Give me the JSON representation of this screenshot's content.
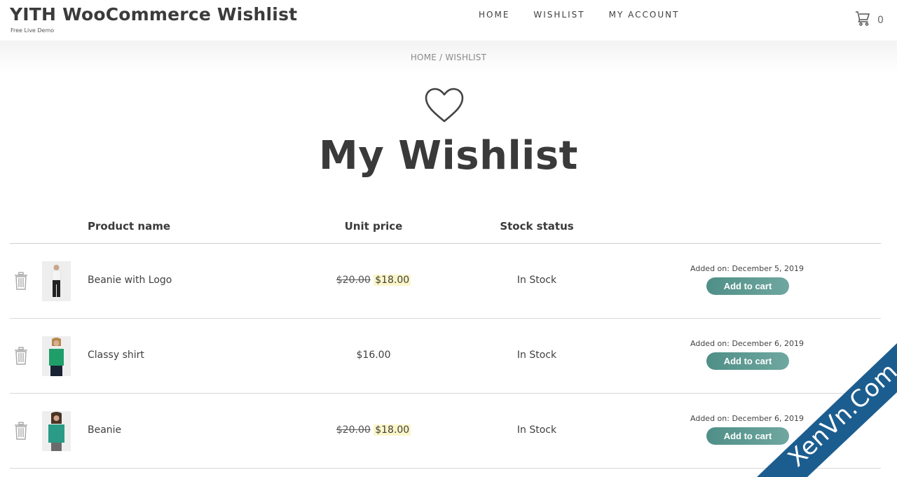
{
  "header": {
    "site_title": "YITH WooCommerce Wishlist",
    "tagline": "Free Live Demo",
    "nav": [
      "HOME",
      "WISHLIST",
      "MY ACCOUNT"
    ],
    "cart_count": "0",
    "cart_icon": "cart-icon"
  },
  "breadcrumb": {
    "home": "HOME",
    "separator": " / ",
    "current": "WISHLIST"
  },
  "page": {
    "icon": "heart-icon",
    "title": "My Wishlist"
  },
  "table": {
    "headers": {
      "product_name": "Product name",
      "unit_price": "Unit price",
      "stock_status": "Stock status"
    },
    "rows": [
      {
        "name": "Beanie with Logo",
        "old_price": "$20.00",
        "price": "$18.00",
        "stock": "In Stock",
        "added": "Added on: December 5, 2019",
        "button": "Add to cart"
      },
      {
        "name": "Classy shirt",
        "old_price": "",
        "price": "$16.00",
        "stock": "In Stock",
        "added": "Added on: December 6, 2019",
        "button": "Add to cart"
      },
      {
        "name": "Beanie",
        "old_price": "$20.00",
        "price": "$18.00",
        "stock": "In Stock",
        "added": "Added on: December 6, 2019",
        "button": "Add to cart"
      }
    ]
  },
  "colors": {
    "accent": "#5e9a92",
    "sale_highlight": "#fbf6c9",
    "text": "#3f3f3f"
  },
  "watermark": "XenVn.Com"
}
